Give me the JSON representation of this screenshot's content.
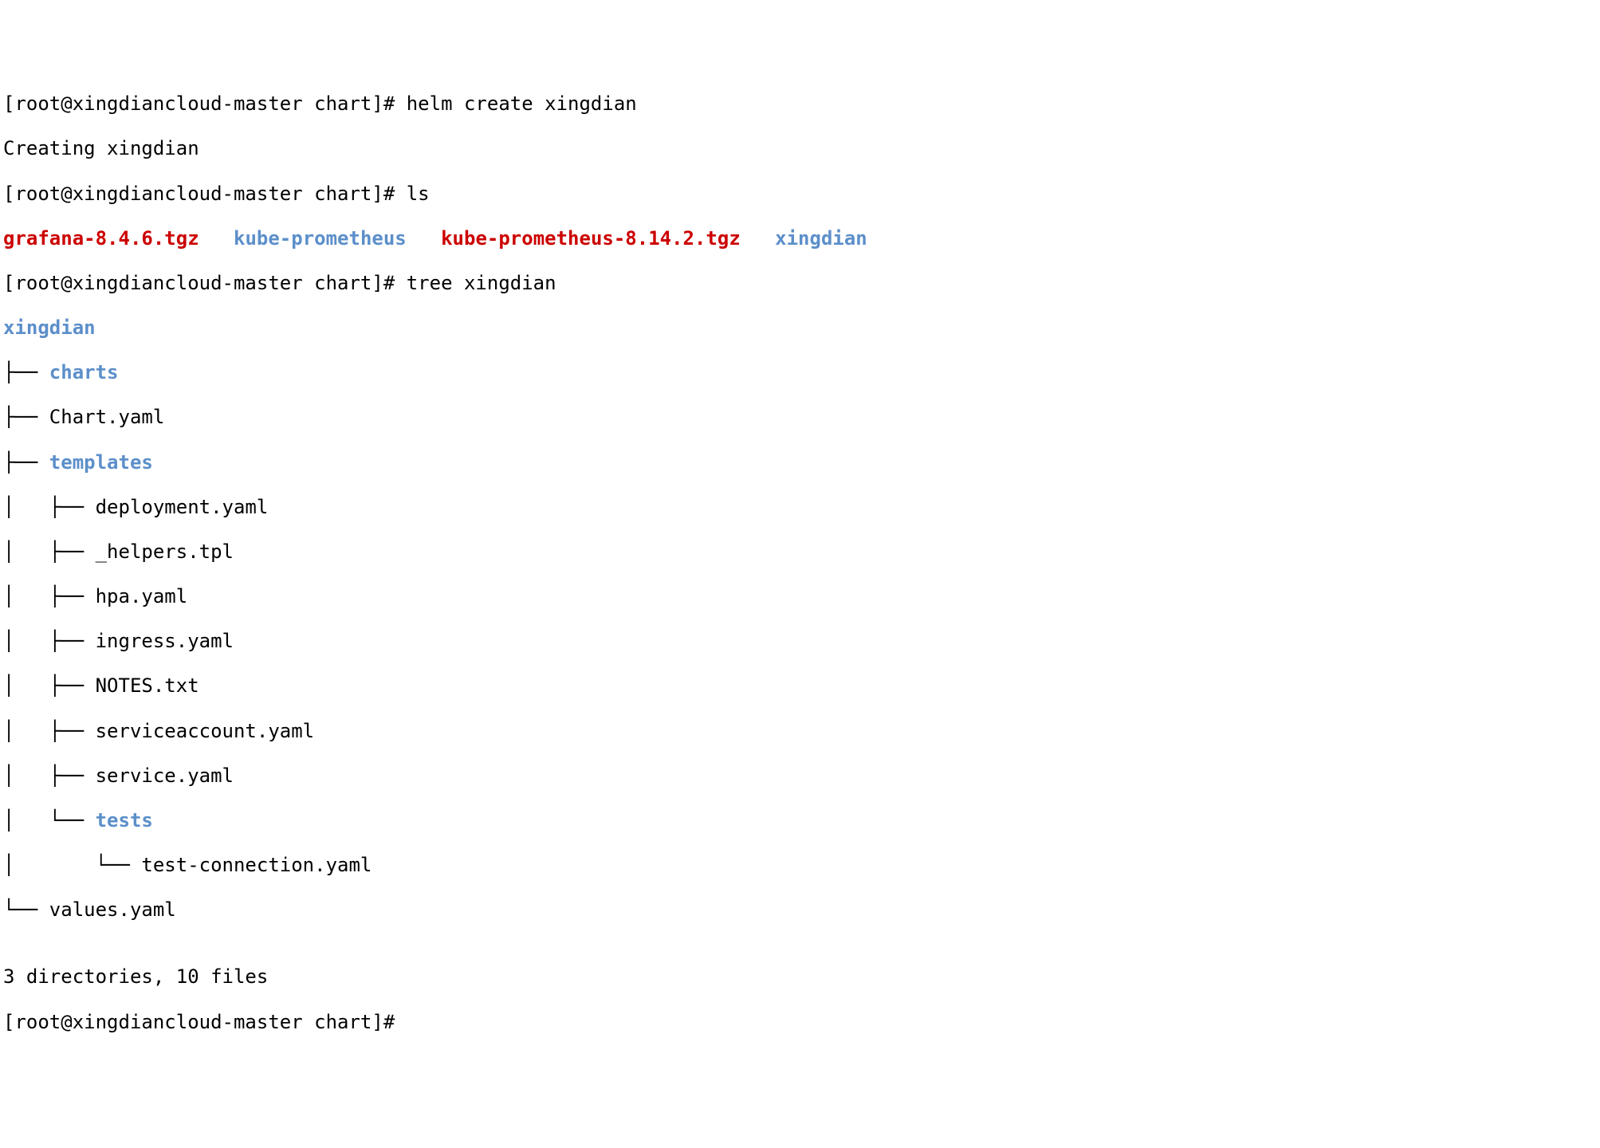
{
  "lines": {
    "l1_prompt": "[root@xingdiancloud-master chart]# ",
    "l1_cmd": "helm create xingdian",
    "l2": "Creating xingdian",
    "l3_prompt": "[root@xingdiancloud-master chart]# ",
    "l3_cmd": "ls",
    "ls": {
      "f1": "grafana-8.4.6.tgz",
      "sp1": "   ",
      "f2": "kube-prometheus",
      "sp2": "   ",
      "f3": "kube-prometheus-8.14.2.tgz",
      "sp3": "   ",
      "f4": "xingdian"
    },
    "l5_prompt": "[root@xingdiancloud-master chart]# ",
    "l5_cmd": "tree xingdian",
    "tree": {
      "root": "xingdian",
      "t1a": "├── ",
      "t1b": "charts",
      "t2": "├── Chart.yaml",
      "t3a": "├── ",
      "t3b": "templates",
      "t4": "│   ├── deployment.yaml",
      "t5": "│   ├── _helpers.tpl",
      "t6": "│   ├── hpa.yaml",
      "t7": "│   ├── ingress.yaml",
      "t8": "│   ├── NOTES.txt",
      "t9": "│   ├── serviceaccount.yaml",
      "t10": "│   ├── service.yaml",
      "t11a": "│   └── ",
      "t11b": "tests",
      "t12": "│       └── test-connection.yaml",
      "t13": "└── values.yaml"
    },
    "blank": "",
    "summary": "3 directories, 10 files",
    "last_prompt": "[root@xingdiancloud-master chart]# "
  }
}
